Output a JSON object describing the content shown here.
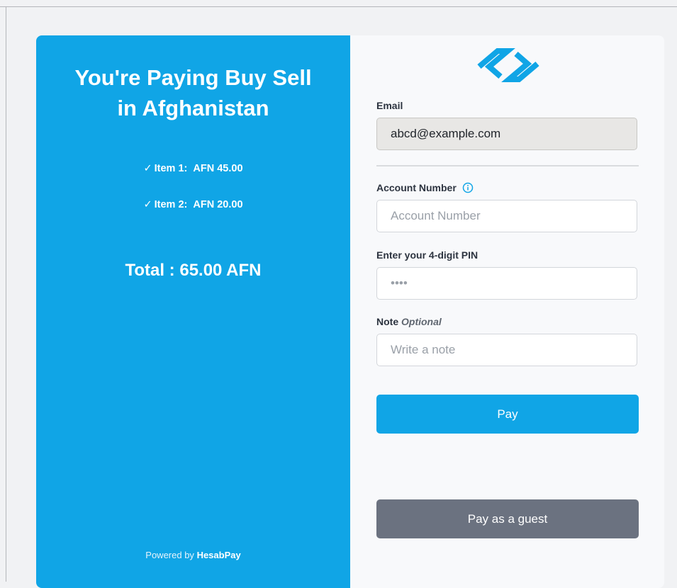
{
  "summary": {
    "title_line1": "You're Paying Buy Sell",
    "title_line2": "in Afghanistan",
    "items": [
      {
        "check": "✓",
        "label": "Item 1:",
        "amount": "AFN 45.00"
      },
      {
        "check": "✓",
        "label": "Item 2:",
        "amount": "AFN 20.00"
      }
    ],
    "total": "Total : 65.00 AFN",
    "powered_prefix": "Powered by",
    "powered_brand": "HesabPay"
  },
  "form": {
    "logo_icon": "hesabpay-logo-icon",
    "email": {
      "label": "Email",
      "value": "abcd@example.com"
    },
    "account": {
      "label": "Account Number",
      "placeholder": "Account Number",
      "info_icon": "info-circle-icon"
    },
    "pin": {
      "label": "Enter your 4-digit PIN",
      "placeholder": "••••"
    },
    "note": {
      "label": "Note",
      "optional": "Optional",
      "placeholder": "Write a note"
    },
    "pay_button": "Pay",
    "guest_button": "Pay as a guest"
  },
  "colors": {
    "brand": "#10a5e6",
    "guest_button": "#6b7280",
    "right_bg": "#f8f9fb"
  }
}
